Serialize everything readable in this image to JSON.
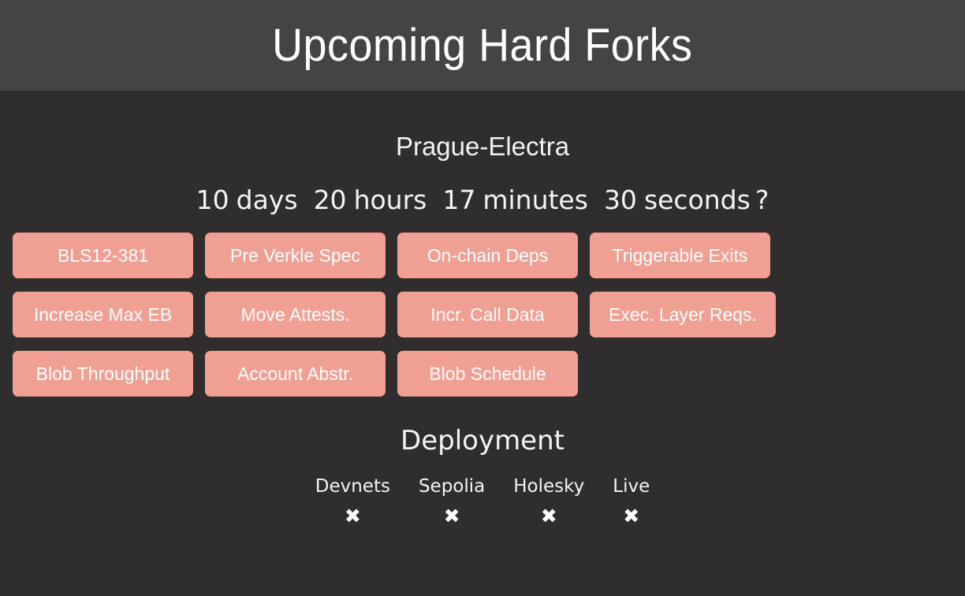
{
  "header": {
    "title": "Upcoming Hard Forks"
  },
  "fork": {
    "name": "Prague-Electra",
    "countdown": {
      "days_value": "10",
      "days_label": "days",
      "hours_value": "20",
      "hours_label": "hours",
      "minutes_value": "17",
      "minutes_label": "minutes",
      "seconds_value": "30",
      "seconds_label": "seconds",
      "suffix": "?"
    },
    "tags": [
      {
        "label": "BLS12-381"
      },
      {
        "label": "Pre Verkle Spec"
      },
      {
        "label": "On-chain Deps"
      },
      {
        "label": "Triggerable Exits"
      },
      {
        "label": "Increase Max EB"
      },
      {
        "label": "Move Attests."
      },
      {
        "label": "Incr. Call Data"
      },
      {
        "label": "Exec. Layer Reqs."
      },
      {
        "label": "Blob Throughput"
      },
      {
        "label": "Account Abstr."
      },
      {
        "label": "Blob Schedule"
      }
    ]
  },
  "deployment": {
    "title": "Deployment",
    "columns": [
      {
        "label": "Devnets",
        "status": "✖"
      },
      {
        "label": "Sepolia",
        "status": "✖"
      },
      {
        "label": "Holesky",
        "status": "✖"
      },
      {
        "label": "Live",
        "status": "✖"
      }
    ]
  },
  "colors": {
    "header_bg": "#454343",
    "card_bg": "#2f2d2d",
    "tag_bg": "#f0a093",
    "text": "#f4f4f4"
  }
}
